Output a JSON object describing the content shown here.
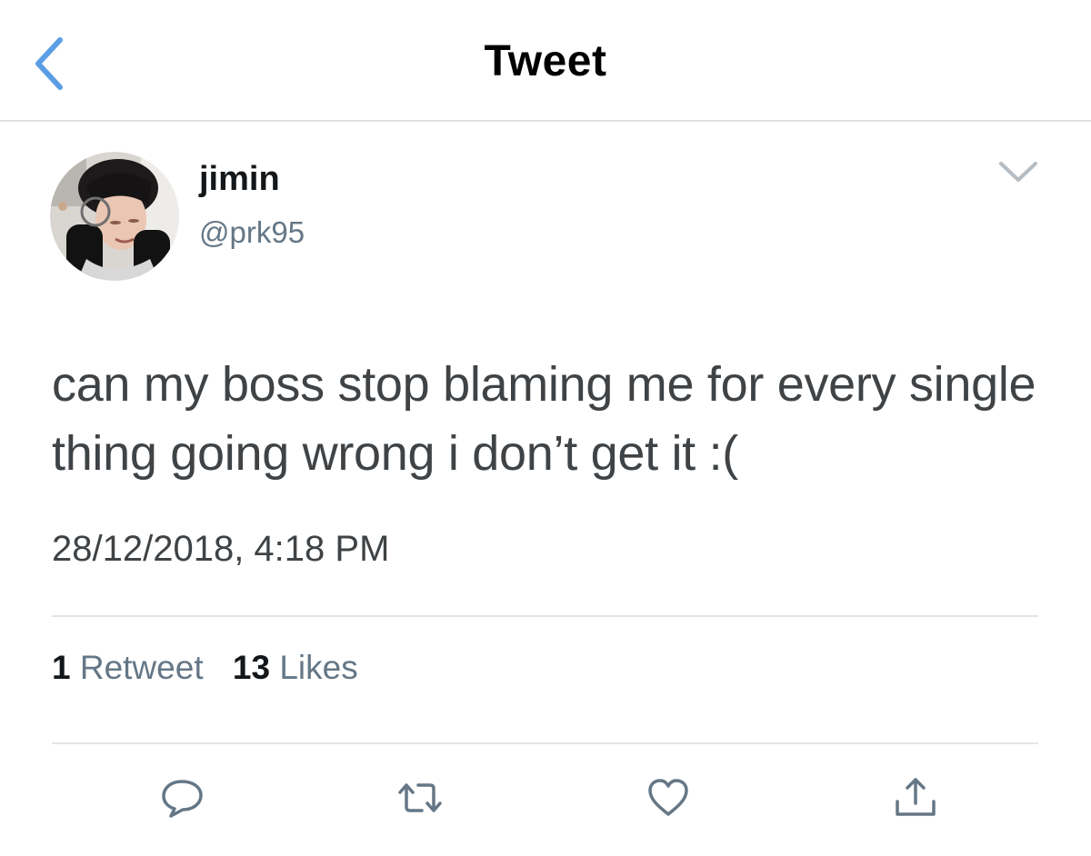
{
  "header": {
    "title": "Tweet",
    "back_icon": "chevron-left-icon"
  },
  "tweet": {
    "author": {
      "display_name": "jimin",
      "handle": "@prk95"
    },
    "text": "can my boss stop blaming me for every single thing going wrong i don’t get it :(",
    "timestamp": "28/12/2018, 4:18 PM",
    "more_icon": "chevron-down-icon"
  },
  "stats": {
    "retweets": {
      "count": "1",
      "label": "Retweet"
    },
    "likes": {
      "count": "13",
      "label": "Likes"
    }
  },
  "actions": [
    {
      "name": "reply",
      "icon": "reply-icon"
    },
    {
      "name": "retweet",
      "icon": "retweet-icon"
    },
    {
      "name": "like",
      "icon": "heart-icon"
    },
    {
      "name": "share",
      "icon": "share-icon"
    }
  ],
  "colors": {
    "accent": "#5b9ee5",
    "icon_gray": "#657786",
    "text_primary": "#14171a",
    "text_secondary": "#657786",
    "divider": "#e1e5e8"
  }
}
